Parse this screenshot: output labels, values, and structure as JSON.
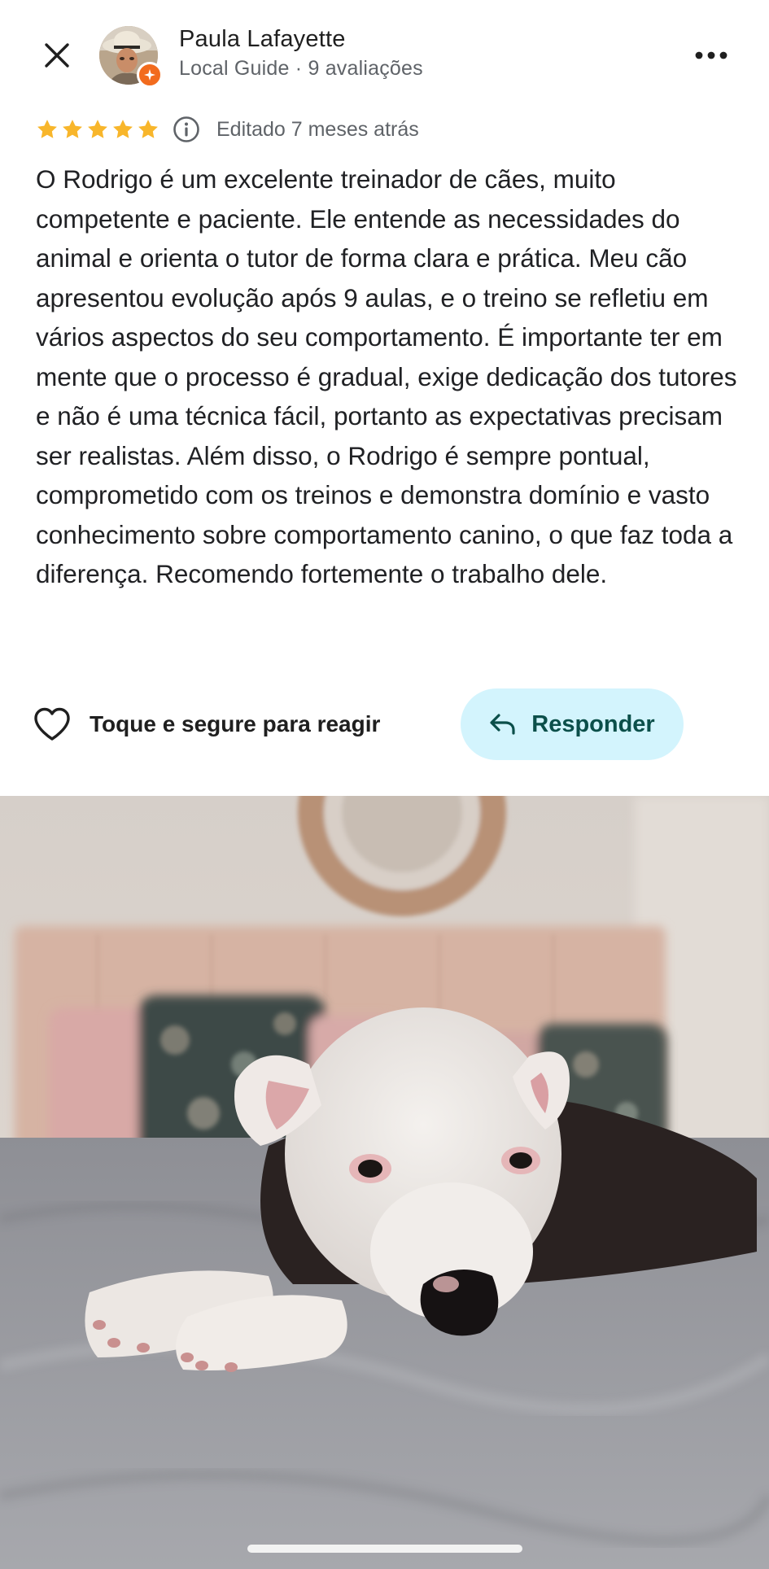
{
  "reviewer": {
    "name": "Paula Lafayette",
    "meta": "Local Guide · 9 avaliações"
  },
  "review": {
    "rating": 5,
    "rating_max": 5,
    "edited": "Editado 7 meses atrás",
    "text": "O Rodrigo é um excelente treinador de cães, muito competente e paciente. Ele entende as necessidades do animal e orienta o tutor de forma clara e prática. Meu cão apresentou evolução após 9 aulas, e o treino se refletiu em vários aspectos do seu comportamento. É importante ter em mente que o processo é gradual, exige dedicação dos tutores e não é uma técnica fácil, portanto as expectativas precisam ser realistas. Além disso, o Rodrigo é sempre pontual, comprometido com os treinos e demonstra domínio e vasto conhecimento sobre comportamento canino, o que faz toda a diferença. Recomendo fortemente o trabalho dele."
  },
  "actions": {
    "react_label": "Toque e segure para reagir",
    "reply_label": "Responder"
  },
  "icons": {
    "close": "close-icon",
    "more": "more-options-icon",
    "star": "star-icon",
    "info": "info-icon",
    "heart": "heart-outline-icon",
    "reply": "reply-arrow-icon",
    "guide_badge": "local-guide-badge-icon"
  },
  "colors": {
    "star": "#F8B62B",
    "reply_bg": "#D3F4FD",
    "reply_text": "#0B4F4A",
    "guide_badge": "#F26B1D",
    "meta_text": "#5F6368"
  }
}
